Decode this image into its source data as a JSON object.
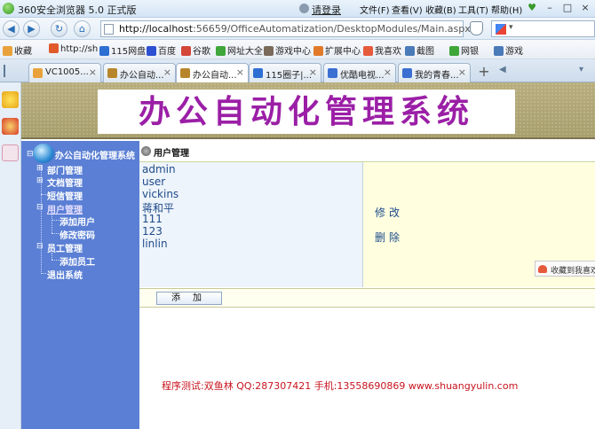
{
  "browser": {
    "title": "360安全浏览器 5.0 正式版",
    "login": "请登录",
    "menu": [
      "文件(F)",
      "查看(V)",
      "收藏(B)",
      "工具(T)",
      "帮助(H)"
    ],
    "url_host": "http://localhost",
    "url_rest": ":56659/OfficeAutomatization/DesktopModules/Main.aspx",
    "bookmarks": [
      {
        "label": "收藏",
        "color": "#e9a23b"
      },
      {
        "label": "http://sh",
        "color": "#e05a2a"
      },
      {
        "label": "115网盘",
        "color": "#2d6fd2"
      },
      {
        "label": "百度",
        "color": "#2d4fd2"
      },
      {
        "label": "谷歌",
        "color": "#d44638"
      },
      {
        "label": "网址大全",
        "color": "#3fa63a"
      },
      {
        "label": "游戏中心",
        "color": "#7a6a5a"
      },
      {
        "label": "扩展中心",
        "color": "#e07a2a"
      },
      {
        "label": "我喜欢",
        "color": "#e65a3c"
      },
      {
        "label": "截图",
        "color": "#4a7ab8"
      },
      {
        "label": "网银",
        "color": "#3fa63a"
      },
      {
        "label": "游戏",
        "color": "#4a7ab8"
      }
    ],
    "tabs": [
      {
        "label": "VC1005...",
        "color": "#e9a23b"
      },
      {
        "label": "办公自动...",
        "color": "#b8862a"
      },
      {
        "label": "办公自动...",
        "color": "#b8862a"
      },
      {
        "label": "115圈子|...",
        "color": "#2d6fd2"
      },
      {
        "label": "优酷电视...",
        "color": "#3b6fd2"
      },
      {
        "label": "我的青春...",
        "color": "#3b6fd2"
      }
    ]
  },
  "app": {
    "banner_title": "办公自动化管理系统",
    "tree_root": "办公自动化管理系统",
    "nav": {
      "dept": "部门管理",
      "docs": "文档管理",
      "sms": "短信管理",
      "users": "用户管理",
      "add_user": "添加用户",
      "change_pwd": "修改密码",
      "staff": "员工管理",
      "add_staff": "添加员工",
      "logout": "退出系统"
    },
    "section_title": "用户管理",
    "users": [
      "admin",
      "user",
      "vickins",
      "蒋和平",
      "111",
      "123",
      "linlin"
    ],
    "modify": "修改",
    "delete": "删除",
    "collect": "收藏到我喜欢",
    "add_button": "添加",
    "footer": "程序测试:双鱼林 QQ:287307421 手机:13558690869 www.shuangyulin.com"
  }
}
